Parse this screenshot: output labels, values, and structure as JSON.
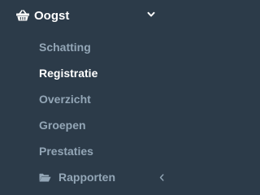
{
  "menu": {
    "title": "Oogst",
    "header_icon": "basket-icon",
    "collapse_icon": "chevron-down-icon",
    "items": [
      {
        "label": "Schatting",
        "active": false
      },
      {
        "label": "Registratie",
        "active": true
      },
      {
        "label": "Overzicht",
        "active": false
      },
      {
        "label": "Groepen",
        "active": false
      },
      {
        "label": "Prestaties",
        "active": false
      },
      {
        "label": "Rapporten",
        "icon": "folder-open-icon",
        "expand_icon": "chevron-left-icon",
        "active": false
      }
    ]
  },
  "colors": {
    "background": "#2c3b49",
    "active_text": "#ffffff",
    "inactive_text": "#93a6b6"
  }
}
